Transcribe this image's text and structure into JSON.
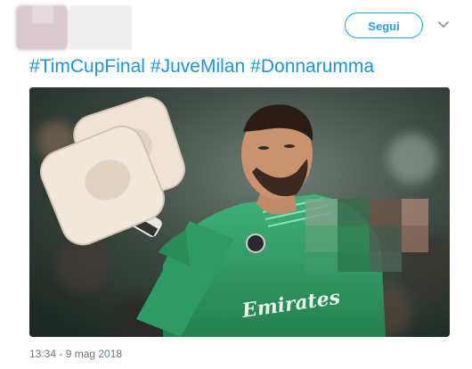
{
  "header": {
    "follow_label": "Segui"
  },
  "hashtags": [
    "#TimCupFinal",
    "#JuveMilan",
    "#Donnarumma"
  ],
  "photo": {
    "jersey_sponsor_text": "Emirates"
  },
  "timestamp": "13:34 - 9 mag 2018",
  "colors": {
    "accent": "#1da1f2",
    "hashtag": "#1b95e0",
    "muted": "#657786",
    "jersey": "#2e9d63"
  },
  "icons": [
    "chevron-down-icon"
  ]
}
